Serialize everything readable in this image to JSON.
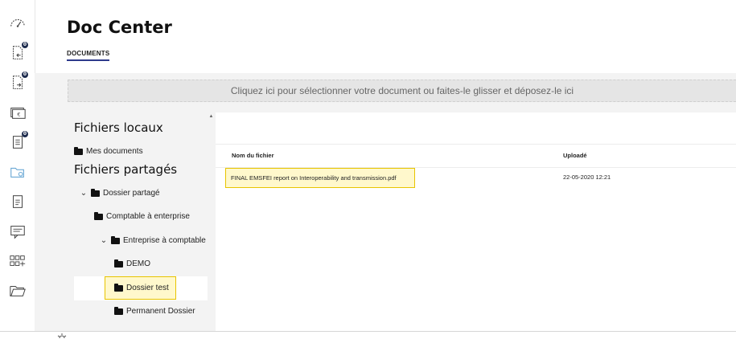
{
  "header": {
    "title": "Doc Center",
    "tab_documents": "DOCUMENTS"
  },
  "rail": {
    "icons": [
      "gauge-icon",
      "doc-in-icon",
      "doc-out-icon",
      "invoice-icon",
      "checklist-icon",
      "folder-search-icon",
      "document-icon",
      "message-icon",
      "apps-icon",
      "folder-open-icon"
    ],
    "badges": {
      "doc_in": "0",
      "doc_out": "0",
      "checklist": "0"
    }
  },
  "dropzone": {
    "text": "Cliquez ici pour sélectionner votre document ou faites-le glisser et déposez-le ici"
  },
  "tree": {
    "local_heading": "Fichiers locaux",
    "my_documents": "Mes documents",
    "shared_heading": "Fichiers partagés",
    "shared_folder": "Dossier partagé",
    "accountant_to_enterprise": "Comptable à enterprise",
    "enterprise_to_accountant": "Entreprise à comptable",
    "demo": "DEMO",
    "test_folder": "Dossier test",
    "permanent_folder": "Permanent Dossier"
  },
  "files": {
    "col_name": "Nom du fichier",
    "col_uploaded": "Uploadé",
    "rows": [
      {
        "name": "FINAL EMSFEI report on Interoperability and transmission.pdf",
        "uploaded": "22-05-2020 12:21"
      }
    ]
  },
  "colors": {
    "accent": "#2e3a8c",
    "highlight": "#e8c400",
    "badge": "#1d2b4d"
  }
}
